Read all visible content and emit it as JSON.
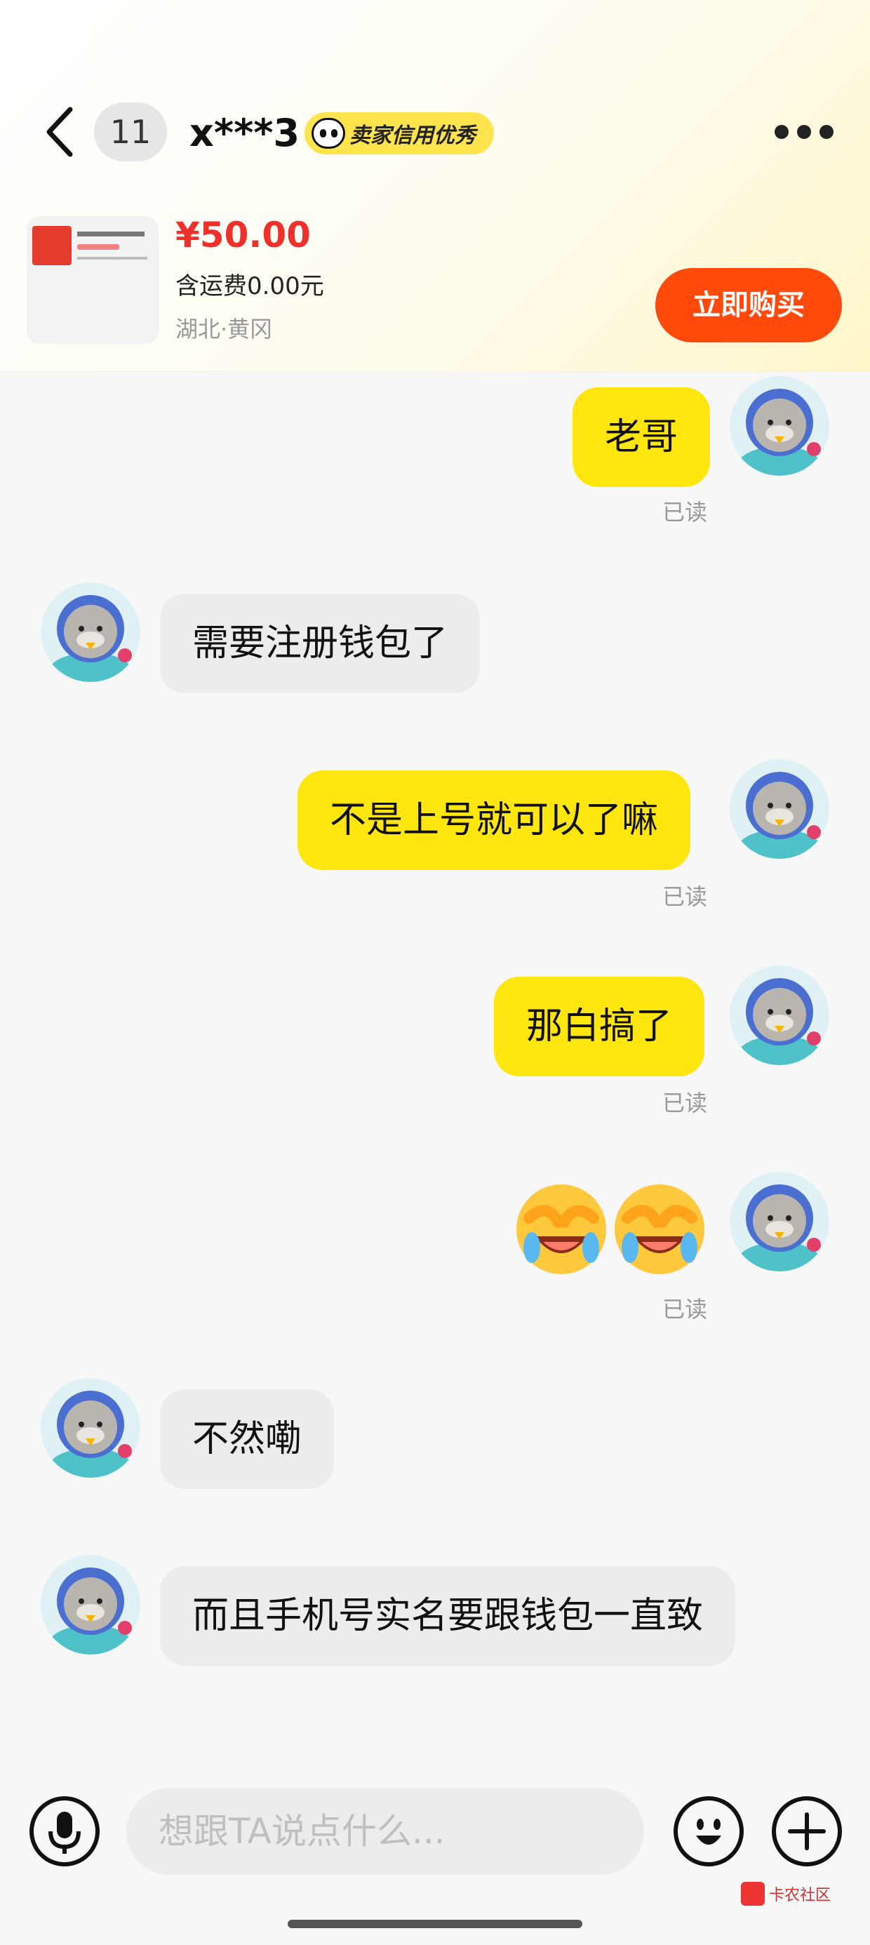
{
  "header": {
    "unread_count": "11",
    "contact_name": "x***3",
    "seller_badge": "卖家信用优秀",
    "icons": [
      "back-arrow-icon",
      "more-icon",
      "eyes-icon"
    ]
  },
  "item": {
    "price": "¥50.00",
    "shipping": "含运费0.00元",
    "location": "湖北·黄冈",
    "buy_label": "立即购买",
    "buy_color": "#ff4a0c"
  },
  "messages": [
    {
      "from": "me",
      "text": "老哥",
      "status": "已读"
    },
    {
      "from": "them",
      "text": "需要注册钱包了"
    },
    {
      "from": "me",
      "text": "不是上号就可以了嘛",
      "status": "已读"
    },
    {
      "from": "me",
      "text": "那白搞了",
      "status": "已读"
    },
    {
      "from": "me",
      "emoji": [
        "crying-laughing-emoji",
        "crying-laughing-emoji"
      ],
      "status": "已读"
    },
    {
      "from": "them",
      "text": "不然嘞"
    },
    {
      "from": "them",
      "text": "而且手机号实名要跟钱包一直致"
    }
  ],
  "composer": {
    "placeholder": "想跟TA说点什么...",
    "icons": [
      "microphone-icon",
      "emoji-icon",
      "add-icon"
    ]
  },
  "watermark": {
    "text": "卡农社区"
  },
  "colors": {
    "my_bubble": "#ffe60f",
    "their_bubble": "#ececec",
    "price": "#f0302a",
    "badge": "#ffe44d"
  }
}
